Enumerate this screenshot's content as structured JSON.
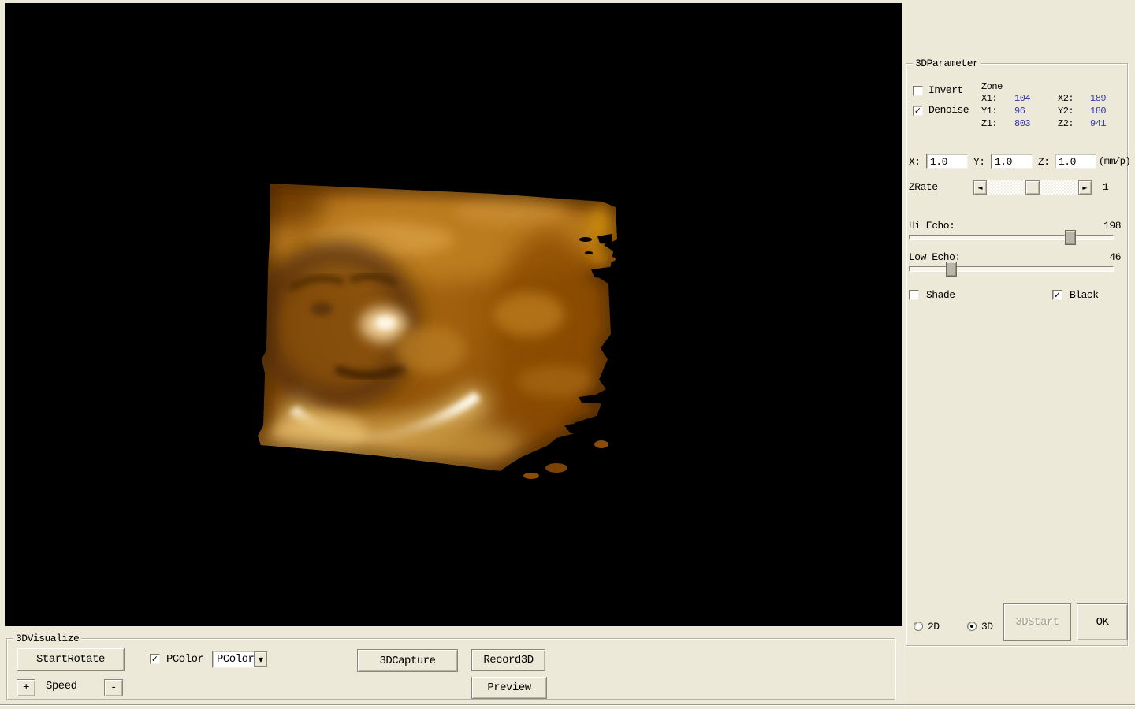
{
  "colors": {
    "panel_bg": "#ece9d8",
    "value_text": "#3333aa",
    "viewport_bg": "#000000"
  },
  "icons": {
    "check": "✓",
    "dropdown": "▼",
    "scroll_left": "◄",
    "scroll_right": "►"
  },
  "param_panel": {
    "title": "3DParameter",
    "invert_label": "Invert",
    "denoise_label": "Denoise",
    "zone": {
      "title": "Zone",
      "x1_label": "X1:",
      "x1_value": "104",
      "x2_label": "X2:",
      "x2_value": "189",
      "y1_label": "Y1:",
      "y1_value": "96",
      "y2_label": "Y2:",
      "y2_value": "180",
      "z1_label": "Z1:",
      "z1_value": "803",
      "z2_label": "Z2:",
      "z2_value": "941"
    },
    "scale": {
      "x_label": "X:",
      "x_value": "1.0",
      "y_label": "Y:",
      "y_value": "1.0",
      "z_label": "Z:",
      "z_value": "1.0",
      "unit": "(mm/p)"
    },
    "zrate_label": "ZRate",
    "zrate_value": "1",
    "hi_echo_label": "Hi Echo:",
    "hi_echo_value": "198",
    "low_echo_label": "Low Echo:",
    "low_echo_value": "46",
    "shade_label": "Shade",
    "black_label": "Black",
    "radio_2d_label": "2D",
    "radio_3d_label": "3D",
    "start3d_label": "3DStart",
    "ok_label": "OK"
  },
  "visualize_panel": {
    "title": "3DVisualize",
    "start_rotate_label": "StartRotate",
    "pcolor_label": "PColor",
    "pcolor_selected": "PColor",
    "capture_label": "3DCapture",
    "record_label": "Record3D",
    "preview_label": "Preview",
    "speed_label": "Speed",
    "speed_plus": "+",
    "speed_minus": "-"
  },
  "states": {
    "invert_checked": false,
    "denoise_checked": true,
    "shade_checked": false,
    "black_checked": true,
    "pcolor_checked": true,
    "mode_selected": "3D",
    "start3d_enabled": false
  }
}
